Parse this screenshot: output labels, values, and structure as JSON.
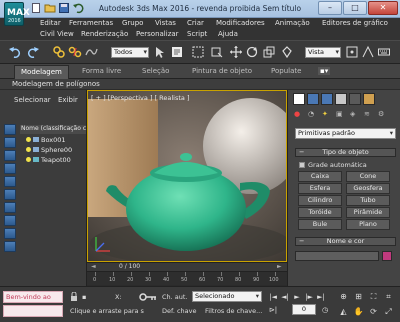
{
  "app": {
    "title": "Autodesk 3ds Max 2016  -  revenda proibida     Sem título",
    "icon_label": "MAX",
    "icon_year": "2016"
  },
  "menu_row1": [
    "Editar",
    "Ferramentas",
    "Grupo",
    "Vistas",
    "Criar",
    "Modificadores",
    "Animação",
    "Editores de gráfico"
  ],
  "menu_row2": [
    "Civil View",
    "Renderização",
    "Personalizar",
    "Script",
    "Ajuda"
  ],
  "toolbar": {
    "selection_filter": "Todos",
    "reference_coord": "Vista"
  },
  "ribbon": {
    "tabs": [
      "Modelagem",
      "Forma livre",
      "Seleção",
      "Pintura de objeto",
      "Populate"
    ],
    "active_tab": "Modelagem",
    "subpanel": "Modelagem de polígonos"
  },
  "explorer": {
    "tabs": [
      "Selecionar",
      "Exibir"
    ],
    "column_header": "Nome (classificação c",
    "rows": [
      "Box001",
      "Sphere00",
      "Teapot00"
    ]
  },
  "viewport": {
    "label": "[ + ] [Perspectiva ] [ Realista ]",
    "frame_counter": "0 / 100",
    "ruler_ticks": [
      "0",
      "10",
      "20",
      "30",
      "40",
      "50",
      "60",
      "70",
      "80",
      "90",
      "100"
    ]
  },
  "command_panel": {
    "category": "Primitivas padrão",
    "object_type_title": "Tipo de objeto",
    "autogrid": "Grade automática",
    "buttons": [
      "Caixa",
      "Cone",
      "Esfera",
      "Geosfera",
      "Cilindro",
      "Tubo",
      "Toróide",
      "Pirâmide",
      "Bule",
      "Plano"
    ],
    "name_color_title": "Nome e cor",
    "object_color": "#c03a7e"
  },
  "status": {
    "welcome": "Bem-vindo ao",
    "hint": "Clique e arraste para s",
    "x_label": "X:",
    "auto_key": "Ch. aut.",
    "set_key": "Def. chave",
    "selection_set": "Selecionado",
    "key_filters": "Filtros de chave...",
    "frame_value": "0"
  },
  "colors": {
    "viewport_border": "#c9a200",
    "teapot": "#2fb58a",
    "titlebar": "#b9d1ea"
  }
}
